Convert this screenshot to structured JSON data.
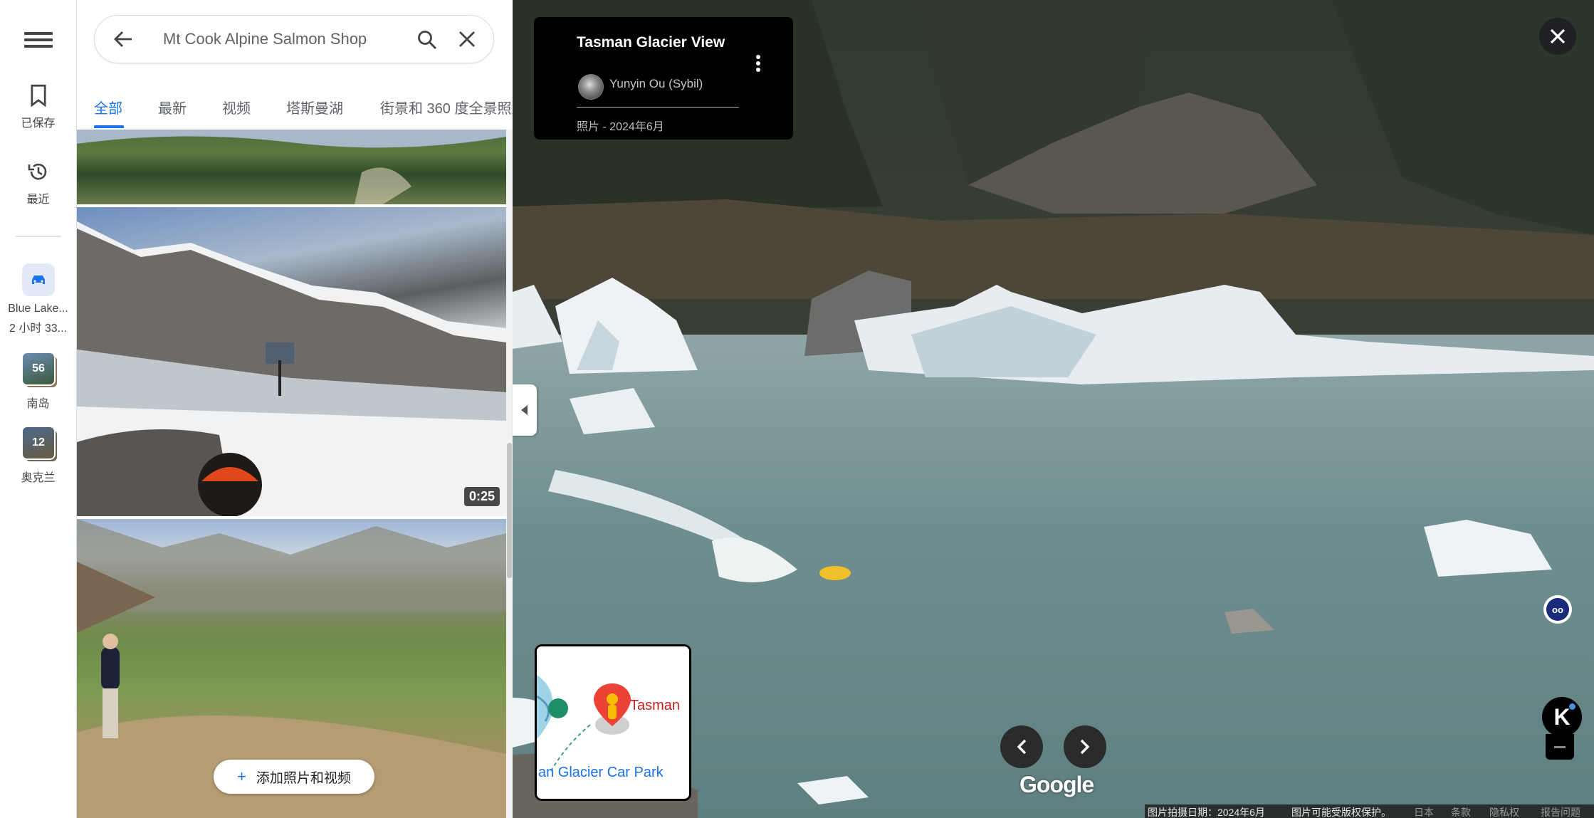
{
  "search": {
    "query": "Mt Cook Alpine Salmon Shop"
  },
  "rail": {
    "saved_label": "已保存",
    "recent_label": "最近",
    "recent_items": [
      {
        "title": "Blue Lake...",
        "subtitle": "2 小时 33..."
      },
      {
        "count": "56",
        "label": "南岛"
      },
      {
        "count": "12",
        "label": "奥克兰"
      }
    ]
  },
  "tabs": [
    "全部",
    "最新",
    "视频",
    "塔斯曼湖",
    "街景和 360 度全景照片"
  ],
  "media": {
    "video_duration": "0:25",
    "add_button": "添加照片和视频"
  },
  "viewer": {
    "title": "Tasman Glacier View",
    "author": "Yunyin Ou (Sybil)",
    "date_line": "照片 - 2024年6月",
    "minimap_place": "Tasman",
    "minimap_parking": "an Glacier Car Park",
    "logo": "Google",
    "k_button": "K",
    "pegman_badge": "oo"
  },
  "footer": {
    "capture_date": "图片拍摄日期：2024年6月",
    "copyright": "图片可能受版权保护。",
    "region": "日本",
    "terms": "条款",
    "privacy": "隐私权",
    "report": "报告问题"
  },
  "colors": {
    "accent": "#1a73e8",
    "pin": "#ea4335",
    "panel_bg": "#ffffff",
    "viewer_chip": "#000000"
  }
}
